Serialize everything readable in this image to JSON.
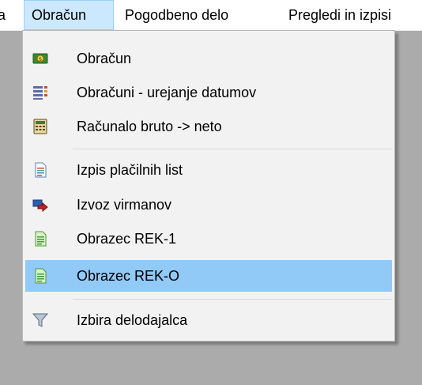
{
  "menubar": {
    "items": [
      {
        "label": "a"
      },
      {
        "label": "Obračun"
      },
      {
        "label": "Pogodbeno delo"
      },
      {
        "label": "Pregledi in izpisi"
      }
    ]
  },
  "dropdown": {
    "items": [
      {
        "label": "Obračun",
        "icon": "money-calculator-icon"
      },
      {
        "label": "Obračuni - urejanje datumov",
        "icon": "list-grid-icon"
      },
      {
        "label": "Računalo bruto -> neto",
        "icon": "calculator-icon"
      },
      {
        "label": "Izpis plačilnih list",
        "icon": "document-icon"
      },
      {
        "label": "Izvoz virmanov",
        "icon": "export-arrow-icon"
      },
      {
        "label": "Obrazec REK-1",
        "icon": "green-document-icon"
      },
      {
        "label": "Obrazec REK-O",
        "icon": "green-document-icon"
      },
      {
        "label": "Izbira delodajalca",
        "icon": "filter-icon"
      }
    ],
    "highlighted_item": "Obrazec REK-O"
  },
  "colors": {
    "menubar_active_bg": "#cce8ff",
    "menubar_active_border": "#99d1ff",
    "highlight_bg": "#91c9f7",
    "menu_bg": "#f2f2f2",
    "backdrop": "#ababab"
  }
}
